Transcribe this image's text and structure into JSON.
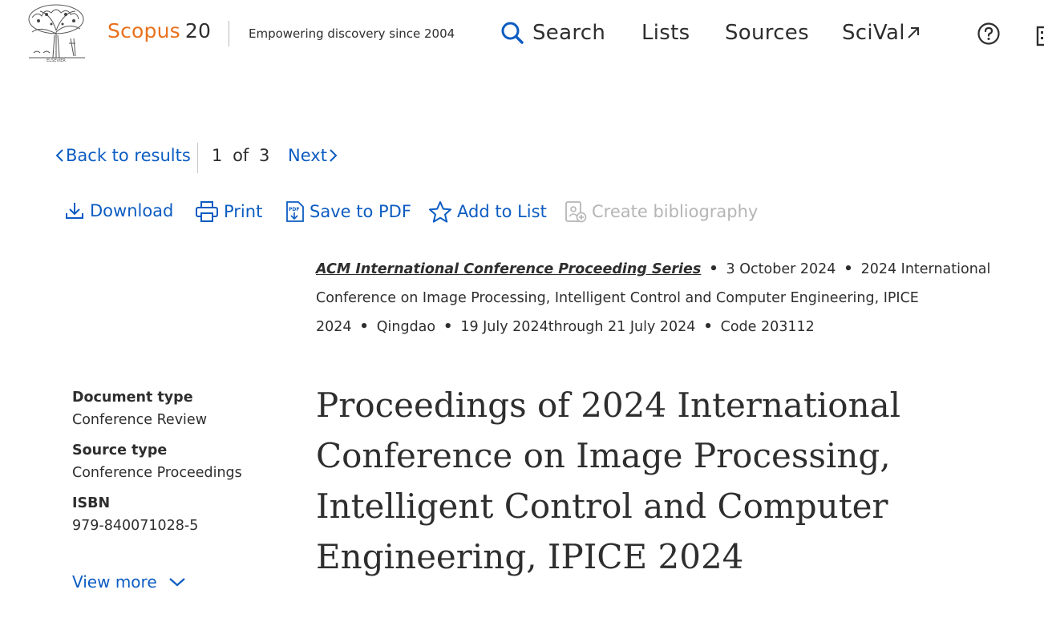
{
  "header": {
    "brand_name": "Scopus",
    "brand_number": "20",
    "tagline": "Empowering discovery since 2004",
    "nav": {
      "search": "Search",
      "lists": "Lists",
      "sources": "Sources",
      "scival": "SciVal"
    }
  },
  "results_nav": {
    "back": "Back to results",
    "current": "1",
    "of": "of",
    "total": "3",
    "next": "Next"
  },
  "actions": {
    "download": "Download",
    "print": "Print",
    "save_pdf": "Save to PDF",
    "add_list": "Add to List",
    "create_bib": "Create bibliography"
  },
  "meta": {
    "series": "ACM International Conference Proceeding Series",
    "date": "3 October 2024",
    "conference": "2024 International Conference on Image Processing, Intelligent Control and Computer Engineering, IPICE 2024",
    "location": "Qingdao",
    "dates": "19 July 2024through 21 July 2024",
    "code": "Code 203112"
  },
  "details": {
    "doc_type_label": "Document type",
    "doc_type_value": "Conference Review",
    "source_type_label": "Source type",
    "source_type_value": "Conference Proceedings",
    "isbn_label": "ISBN",
    "isbn_value": "979-840071028-5",
    "view_more": "View more"
  },
  "title": "Proceedings of 2024 International Conference on Image Processing, Intelligent Control and Computer Engineering, IPICE 2024",
  "colors": {
    "brand_orange": "#e9711c",
    "link_blue": "#0c5cc2",
    "text": "#2e2e2e",
    "disabled": "#b5b5b5"
  },
  "icons": [
    "elsevier-tree-logo",
    "search-icon",
    "external-arrow-icon",
    "help-icon",
    "institution-icon",
    "chevron-left-icon",
    "chevron-right-icon",
    "download-icon",
    "print-icon",
    "pdf-icon",
    "star-icon",
    "bibliography-icon",
    "chevron-down-icon"
  ]
}
